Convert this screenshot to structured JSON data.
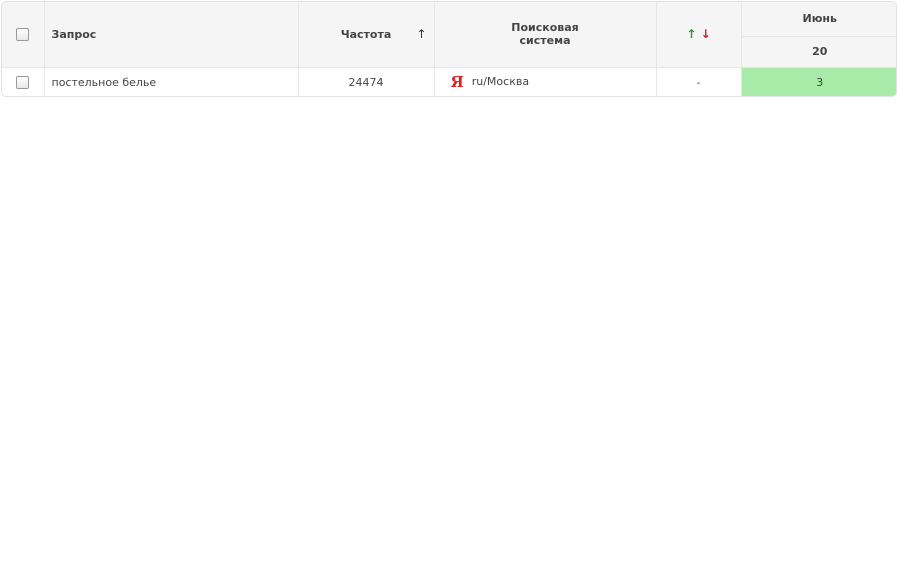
{
  "columns": {
    "query": "Запрос",
    "frequency": "Частота",
    "frequency_sort_icon": "↑",
    "engine_line1": "Поисковая",
    "engine_line2": "система",
    "diff_up": "↑",
    "diff_down": "↓",
    "month": "Июнь",
    "day": "20"
  },
  "rows": [
    {
      "query": "постельное белье",
      "frequency": "24474",
      "engine_icon": "yandex-icon",
      "engine_icon_glyph": "Я",
      "engine_region": "ru/Москва",
      "diff": "-",
      "position": "3"
    }
  ],
  "colors": {
    "position_good": "#a8eba8",
    "arrow_up": "#2a9a2a",
    "arrow_down": "#cc2222",
    "yandex": "#e02020"
  }
}
